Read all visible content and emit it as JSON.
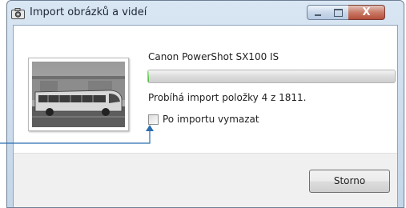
{
  "window": {
    "title": "Import obrázků a videí",
    "icons": {
      "title": "camera-import-icon",
      "minimize": "minimize-icon",
      "maximize": "maximize-icon",
      "close": "close-icon"
    },
    "close_glyph": "X"
  },
  "import": {
    "device_name": "Canon PowerShot SX100 IS",
    "progress_fraction": 0.002,
    "status": "Probíhá import položky 4 z 1811.",
    "delete_after_import_label": "Po importu vymazat",
    "delete_after_import_checked": false
  },
  "buttons": {
    "cancel_label": "Storno"
  },
  "colors": {
    "progress_fill": "#45b135",
    "callout_line": "#2a6db0"
  }
}
